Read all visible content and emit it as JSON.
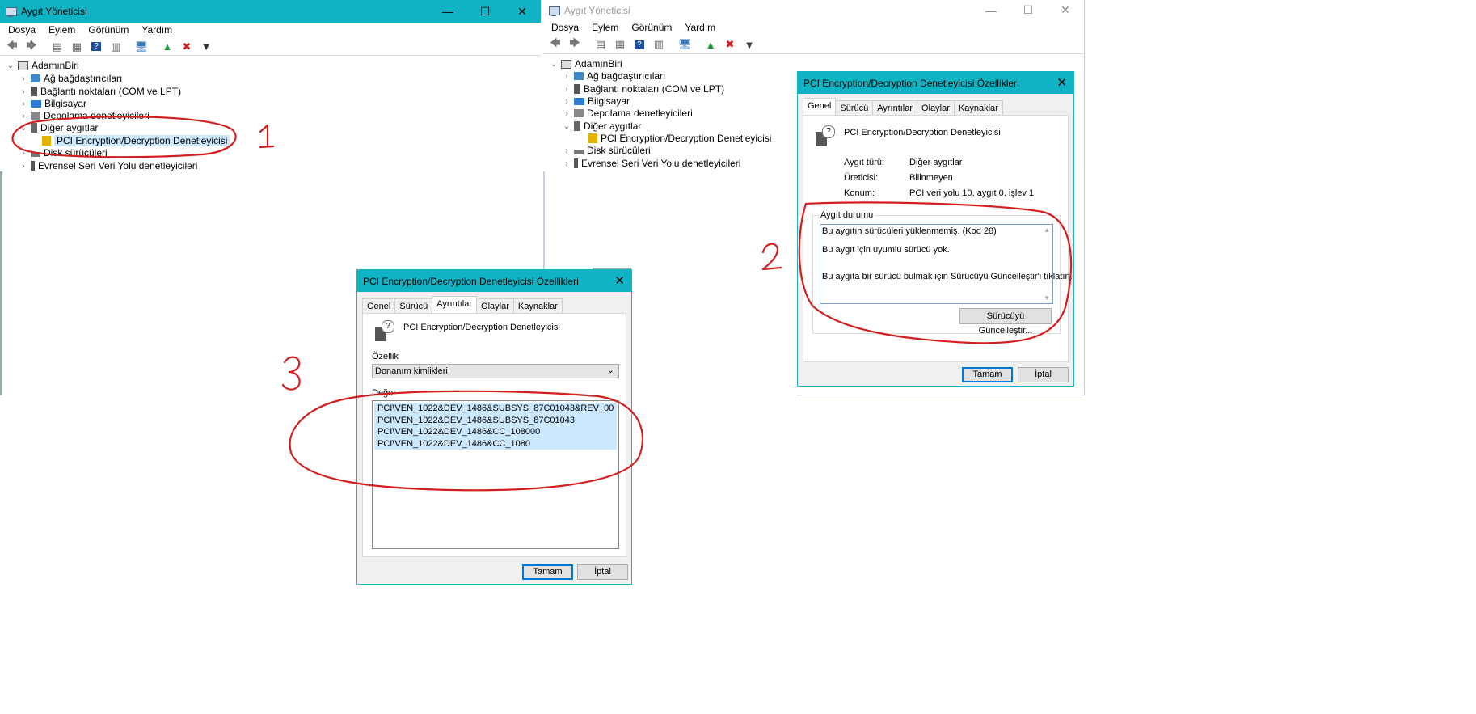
{
  "left_window": {
    "title": "Aygıt Yöneticisi",
    "menu": [
      "Dosya",
      "Eylem",
      "Görünüm",
      "Yardım"
    ],
    "tree": {
      "root": "AdamınBiri",
      "items": [
        "Ağ bağdaştırıcıları",
        "Bağlantı noktaları (COM ve LPT)",
        "Bilgisayar",
        "Depolama denetleyicileri",
        "Diğer aygıtlar",
        "PCI Encryption/Decryption Denetleyicisi",
        "Disk sürücüleri",
        "Evrensel Seri Veri Yolu denetleyicileri"
      ]
    }
  },
  "right_window": {
    "title": "Aygıt Yöneticisi",
    "menu": [
      "Dosya",
      "Eylem",
      "Görünüm",
      "Yardım"
    ],
    "tree": {
      "root": "AdamınBiri",
      "items": [
        "Ağ bağdaştırıcıları",
        "Bağlantı noktaları (COM ve LPT)",
        "Bilgisayar",
        "Depolama denetleyicileri",
        "Diğer aygıtlar",
        "PCI Encryption/Decryption Denetleyicisi",
        "Disk sürücüleri",
        "Evrensel Seri Veri Yolu denetleyicileri"
      ]
    }
  },
  "general_dialog": {
    "title": "PCI Encryption/Decryption Denetleyicisi Özellikleri",
    "tabs": [
      "Genel",
      "Sürücü",
      "Ayrıntılar",
      "Olaylar",
      "Kaynaklar"
    ],
    "device_name": "PCI Encryption/Decryption Denetleyicisi",
    "device_type_label": "Aygıt türü:",
    "device_type_value": "Diğer aygıtlar",
    "manufacturer_label": "Üreticisi:",
    "manufacturer_value": "Bilinmeyen",
    "location_label": "Konum:",
    "location_value": "PCI veri yolu 10, aygıt 0, işlev 1",
    "status_group": "Aygıt durumu",
    "status_lines": [
      "Bu aygıtın sürücüleri yüklenmemiş. (Kod 28)",
      "Bu aygıt için uyumlu sürücü yok.",
      "Bu aygıta bir sürücü bulmak için Sürücüyü Güncelleştir'i tıklatın."
    ],
    "update_button": "Sürücüyü Güncelleştir...",
    "ok_button": "Tamam",
    "cancel_button": "İptal"
  },
  "details_dialog": {
    "title": "PCI Encryption/Decryption Denetleyicisi Özellikleri",
    "tabs": [
      "Genel",
      "Sürücü",
      "Ayrıntılar",
      "Olaylar",
      "Kaynaklar"
    ],
    "device_name": "PCI Encryption/Decryption Denetleyicisi",
    "property_label": "Özellik",
    "property_value": "Donanım kimlikleri",
    "value_label": "Değer",
    "values": [
      "PCI\\VEN_1022&DEV_1486&SUBSYS_87C01043&REV_00",
      "PCI\\VEN_1022&DEV_1486&SUBSYS_87C01043",
      "PCI\\VEN_1022&DEV_1486&CC_108000",
      "PCI\\VEN_1022&DEV_1486&CC_1080"
    ],
    "ok_button": "Tamam",
    "cancel_button": "İptal"
  },
  "annotations": [
    "1",
    "2",
    "3"
  ],
  "colors": {
    "accent": "#0fb3c4",
    "selection": "#cce8ff",
    "annotation": "#d31f1f"
  }
}
